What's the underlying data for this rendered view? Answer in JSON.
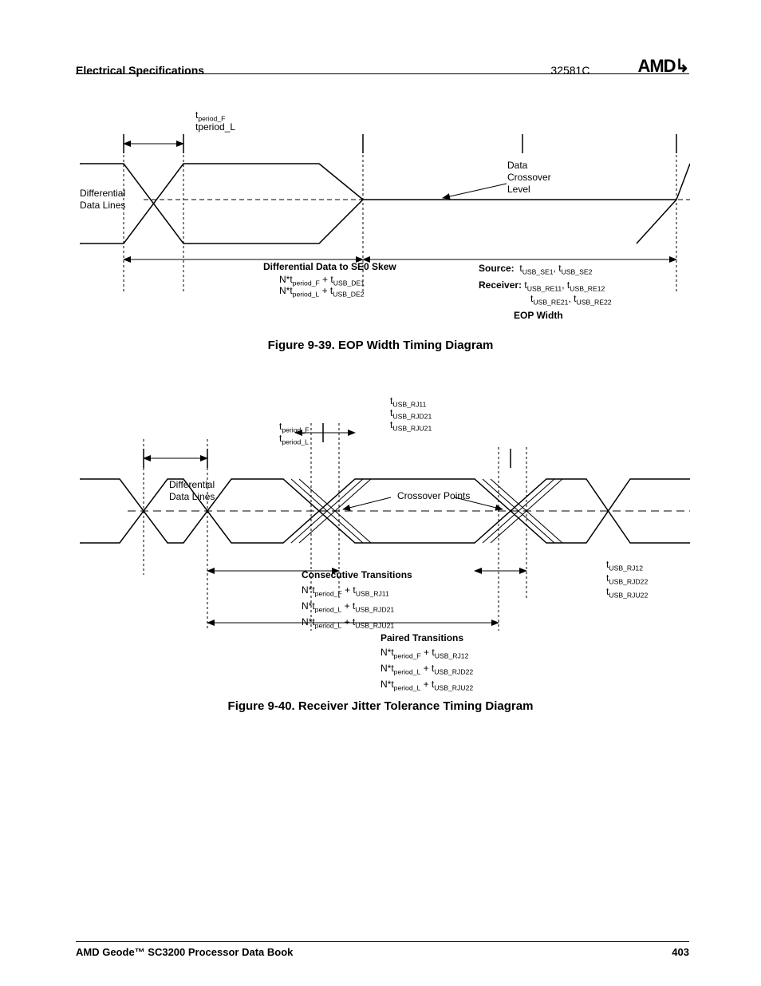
{
  "header": {
    "section": "Electrical Specifications",
    "docnum": "32581C"
  },
  "logo": "AMD",
  "fig1": {
    "caption": "Figure 9-39.  EOP Width Timing Diagram",
    "tperiod_f": "t",
    "tperiod_f_sub": "period_F",
    "tperiod_l": "tperiod_L",
    "diff_lines": "Differential\nData Lines",
    "xover": "Data\nCrossover\nLevel",
    "skew_title": "Differential Data to SE0 Skew",
    "skew1_a": "N*t",
    "skew1_sub": "period_F",
    "skew1_b": " + t",
    "skew1_sub2": "USB_DE1",
    "skew2_a": "N*t",
    "skew2_sub": "period_L",
    "skew2_b": " + t",
    "skew2_sub2": "USB_DE2",
    "source": "Source:",
    "src1": "t",
    "src1s": "USB_SE1",
    "src2": ", t",
    "src2s": "USB_SE2",
    "receiver": "Receiver:",
    "rc1": "t",
    "rc1s": "USB_RE11",
    "rc2": ", t",
    "rc2s": "USB_RE12",
    "rc3": "t",
    "rc3s": "USB_RE21",
    "rc4": ", t",
    "rc4s": "USB_RE22",
    "eop": "EOP Width"
  },
  "fig2": {
    "caption": "Figure 9-40.  Receiver Jitter Tolerance Timing Diagram",
    "tperiod_f": "t",
    "tperiod_f_sub": "period_F",
    "tperiod_l": "t",
    "tperiod_l_sub": "period_L",
    "diff_lines": "Differential\nData Lines",
    "top1": "t",
    "top1s": "USB_RJ11",
    "top2": "t",
    "top2s": "USB_RJD21",
    "top3": "t",
    "top3s": "USB_RJU21",
    "xpts": "Crossover Points",
    "cons": "Consecutive Transitions",
    "c1a": "N*t",
    "c1s": "period_F",
    "c1b": " + t",
    "c1s2": "USB_RJ11",
    "c2a": "N*t",
    "c2s": "period_L",
    "c2b": " + t",
    "c2s2": "USB_RJD21",
    "c3a": "N*t",
    "c3s": "period_L",
    "c3b": " + t",
    "c3s2": "USB_RJU21",
    "right1": "t",
    "right1s": "USB_RJ12",
    "right2": "t",
    "right2s": "USB_RJD22",
    "right3": "t",
    "right3s": "USB_RJU22",
    "paired": "Paired Transitions",
    "p1a": "N*t",
    "p1s": "period_F",
    "p1b": " + t",
    "p1s2": "USB_RJ12",
    "p2a": "N*t",
    "p2s": "period_L",
    "p2b": " + t",
    "p2s2": "USB_RJD22",
    "p3a": "N*t",
    "p3s": "period_L",
    "p3b": " + t",
    "p3s2": "USB_RJU22"
  },
  "footer": {
    "book": "AMD Geode™ SC3200 Processor Data Book",
    "page": "403"
  }
}
